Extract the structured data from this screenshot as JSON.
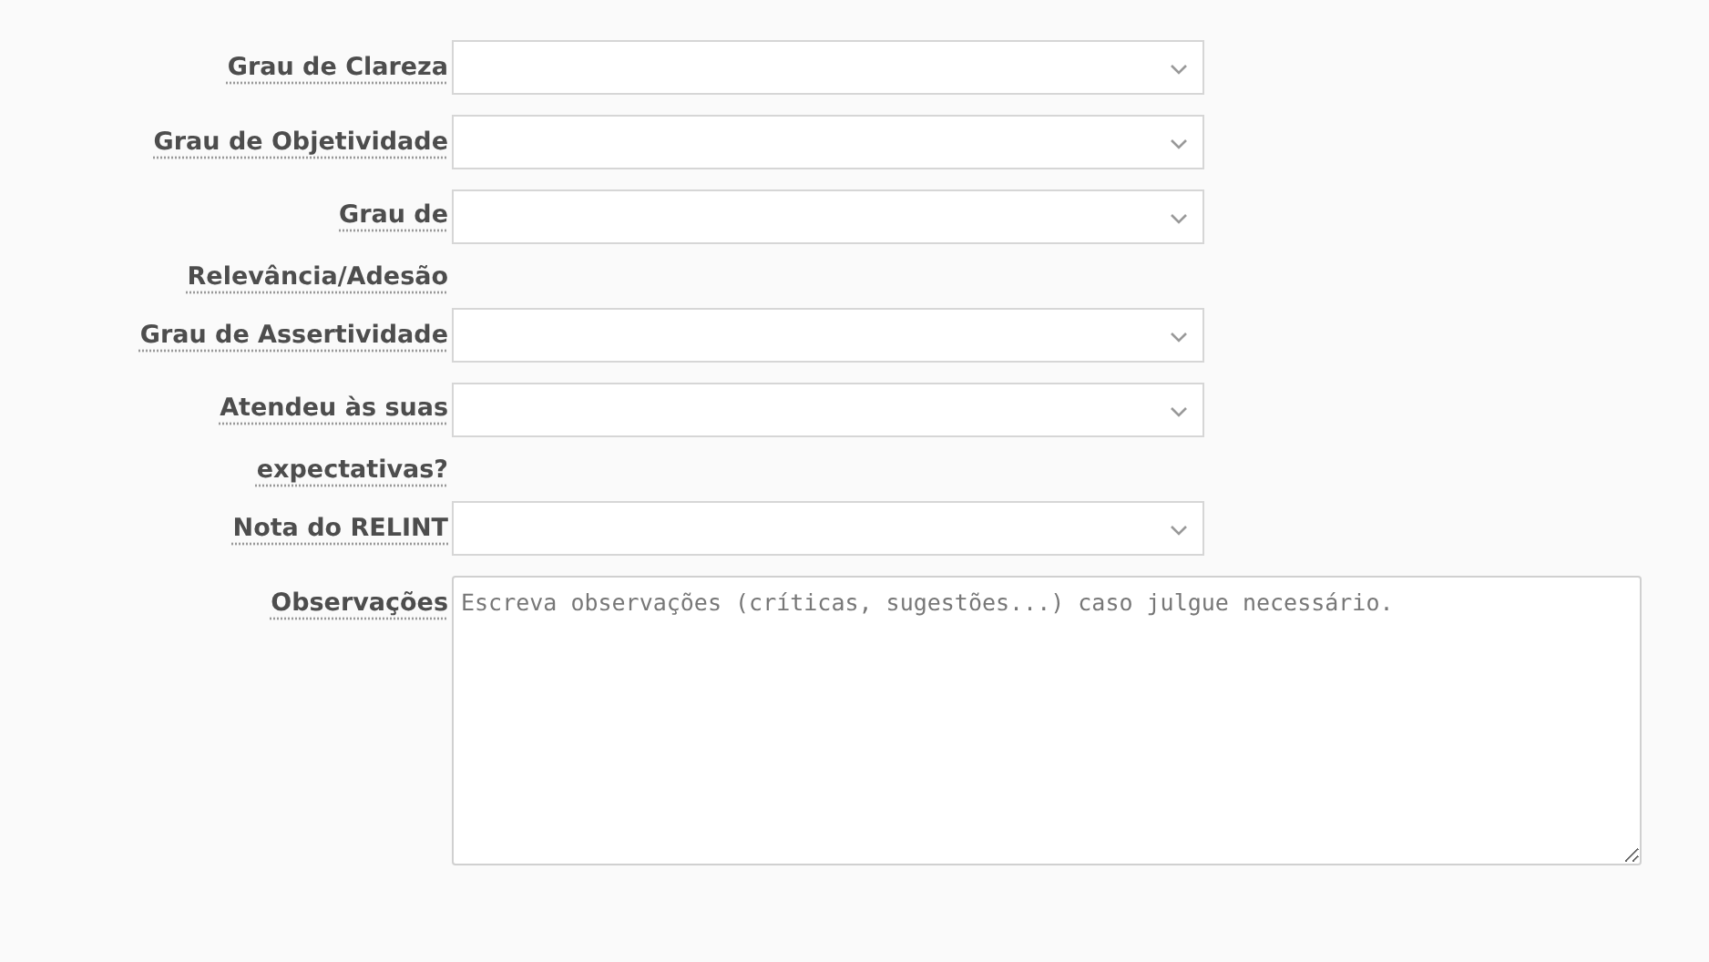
{
  "fields": [
    {
      "kind": "select",
      "label": "Grau de Clareza"
    },
    {
      "kind": "select",
      "label": "Grau de Objetividade"
    },
    {
      "kind": "select",
      "label": "Grau de Relevância/Adesão"
    },
    {
      "kind": "select",
      "label": "Grau de Assertividade"
    },
    {
      "kind": "select",
      "label": "Atendeu às suas expectativas?"
    },
    {
      "kind": "select",
      "label": "Nota do RELINT"
    },
    {
      "kind": "textarea",
      "label": "Observações",
      "placeholder": "Escreva observações (críticas, sugestões...) caso julgue necessário."
    }
  ]
}
